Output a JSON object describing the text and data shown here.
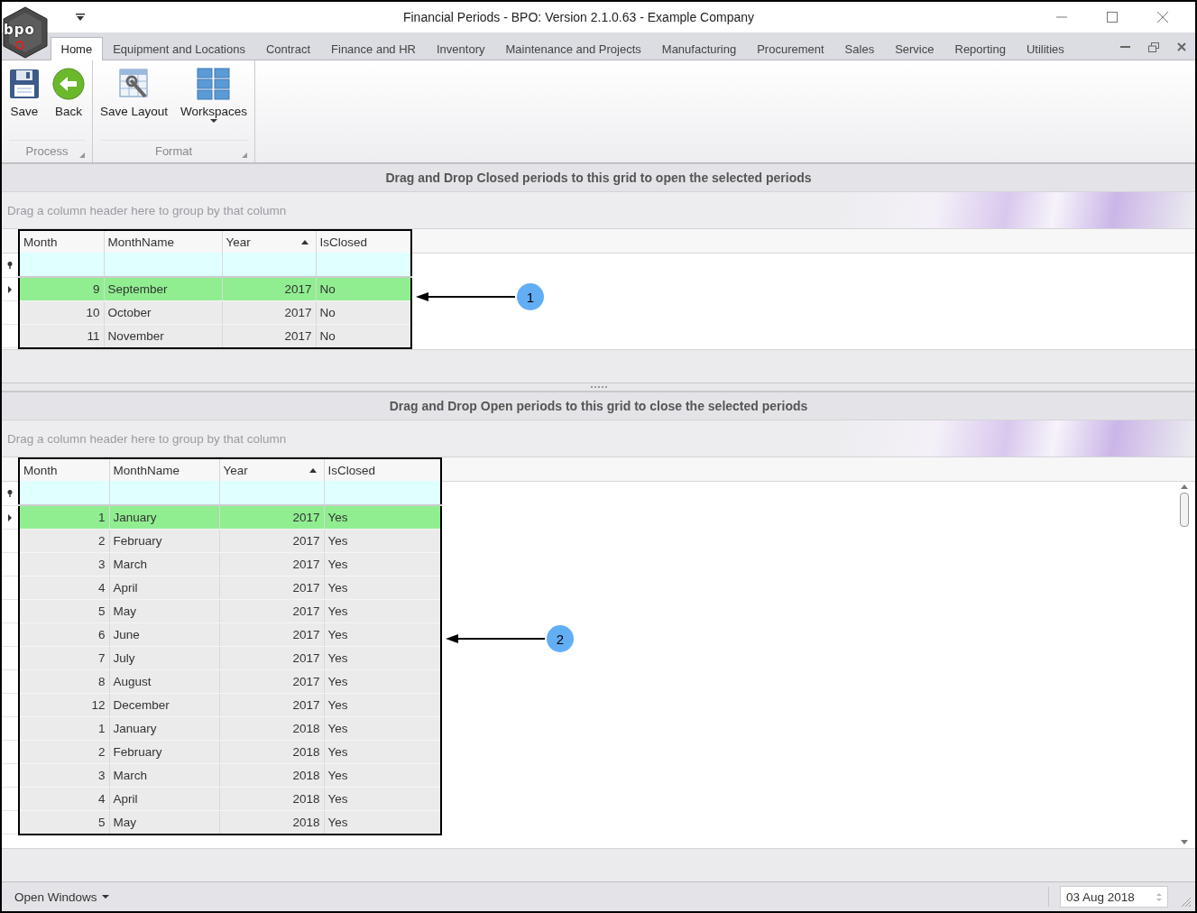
{
  "window": {
    "title": "Financial Periods - BPO: Version 2.1.0.63 - Example Company",
    "logo": "bpo"
  },
  "ribbon": {
    "tabs": [
      {
        "label": "Home",
        "selected": true
      },
      {
        "label": "Equipment and Locations",
        "selected": false
      },
      {
        "label": "Contract",
        "selected": false
      },
      {
        "label": "Finance and HR",
        "selected": false
      },
      {
        "label": "Inventory",
        "selected": false
      },
      {
        "label": "Maintenance and Projects",
        "selected": false
      },
      {
        "label": "Manufacturing",
        "selected": false
      },
      {
        "label": "Procurement",
        "selected": false
      },
      {
        "label": "Sales",
        "selected": false
      },
      {
        "label": "Service",
        "selected": false
      },
      {
        "label": "Reporting",
        "selected": false
      },
      {
        "label": "Utilities",
        "selected": false
      }
    ],
    "groups": [
      {
        "label": "Process",
        "buttons": [
          {
            "label": "Save",
            "kind": "save"
          },
          {
            "label": "Back",
            "kind": "back"
          }
        ]
      },
      {
        "label": "Format",
        "buttons": [
          {
            "label": "Save Layout",
            "kind": "layout"
          },
          {
            "label": "Workspaces",
            "kind": "workspaces",
            "dropdown": true
          }
        ]
      }
    ]
  },
  "panels": [
    {
      "caption": "Drag and Drop Closed periods to this grid to open the selected periods",
      "group_hint": "Drag a column header here to group by that column",
      "scrollbar": false,
      "callout": "1",
      "columns": [
        {
          "label": "Month",
          "sorted": false
        },
        {
          "label": "MonthName",
          "sorted": false
        },
        {
          "label": "Year",
          "sorted": true
        },
        {
          "label": "IsClosed",
          "sorted": false
        }
      ],
      "rows": [
        {
          "cells": [
            "9",
            "September",
            "2017",
            "No"
          ],
          "selected": true
        },
        {
          "cells": [
            "10",
            "October",
            "2017",
            "No"
          ],
          "selected": false
        },
        {
          "cells": [
            "11",
            "November",
            "2017",
            "No"
          ],
          "selected": false
        }
      ]
    },
    {
      "caption": "Drag and Drop Open periods to this grid to close the selected periods",
      "group_hint": "Drag a column header here to group by that column",
      "scrollbar": true,
      "callout": "2",
      "columns": [
        {
          "label": "Month",
          "sorted": false
        },
        {
          "label": "MonthName",
          "sorted": false
        },
        {
          "label": "Year",
          "sorted": true
        },
        {
          "label": "IsClosed",
          "sorted": false
        }
      ],
      "rows": [
        {
          "cells": [
            "1",
            "January",
            "2017",
            "Yes"
          ],
          "selected": true
        },
        {
          "cells": [
            "2",
            "February",
            "2017",
            "Yes"
          ],
          "selected": false
        },
        {
          "cells": [
            "3",
            "March",
            "2017",
            "Yes"
          ],
          "selected": false
        },
        {
          "cells": [
            "4",
            "April",
            "2017",
            "Yes"
          ],
          "selected": false
        },
        {
          "cells": [
            "5",
            "May",
            "2017",
            "Yes"
          ],
          "selected": false
        },
        {
          "cells": [
            "6",
            "June",
            "2017",
            "Yes"
          ],
          "selected": false
        },
        {
          "cells": [
            "7",
            "July",
            "2017",
            "Yes"
          ],
          "selected": false
        },
        {
          "cells": [
            "8",
            "August",
            "2017",
            "Yes"
          ],
          "selected": false
        },
        {
          "cells": [
            "12",
            "December",
            "2017",
            "Yes"
          ],
          "selected": false
        },
        {
          "cells": [
            "1",
            "January",
            "2018",
            "Yes"
          ],
          "selected": false
        },
        {
          "cells": [
            "2",
            "February",
            "2018",
            "Yes"
          ],
          "selected": false
        },
        {
          "cells": [
            "3",
            "March",
            "2018",
            "Yes"
          ],
          "selected": false
        },
        {
          "cells": [
            "4",
            "April",
            "2018",
            "Yes"
          ],
          "selected": false
        },
        {
          "cells": [
            "5",
            "May",
            "2018",
            "Yes"
          ],
          "selected": false
        }
      ]
    }
  ],
  "status_bar": {
    "menu": "Open Windows",
    "date": "03 Aug 2018"
  }
}
